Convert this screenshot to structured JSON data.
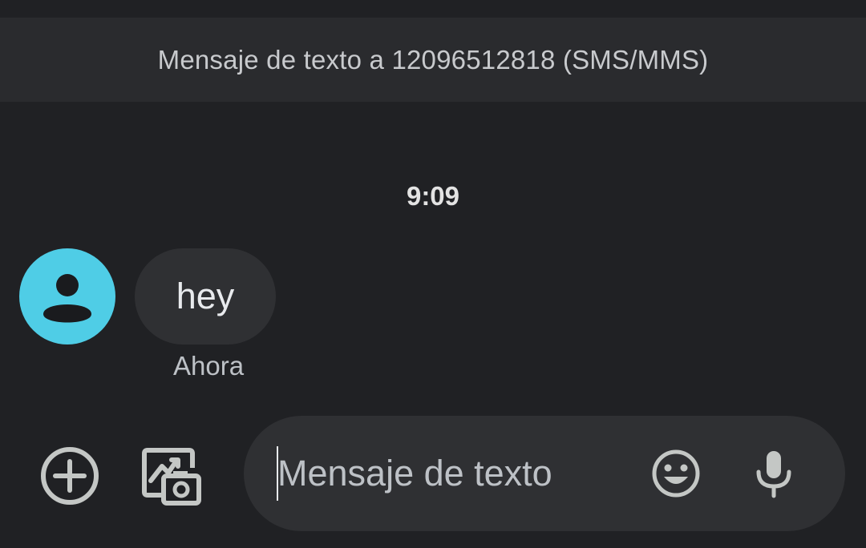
{
  "header": {
    "banner_text": "Mensaje de texto a 12096512818 (SMS/MMS)"
  },
  "conversation": {
    "timestamp": "9:09",
    "messages": [
      {
        "text": "hey",
        "time": "Ahora",
        "direction": "incoming",
        "avatar_icon": "person-icon"
      }
    ]
  },
  "composer": {
    "placeholder": "Mensaje de texto",
    "value": "",
    "add_icon": "plus-circle-icon",
    "media_icon": "gallery-camera-icon",
    "emoji_icon": "emoji-icon",
    "mic_icon": "microphone-icon"
  },
  "colors": {
    "background": "#202124",
    "banner": "#2a2b2e",
    "bubble": "#2f3033",
    "avatar": "#4fcde6",
    "icon": "#c4c7c5"
  }
}
